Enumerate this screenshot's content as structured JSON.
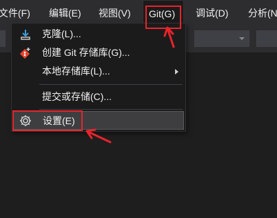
{
  "menubar": {
    "items": [
      {
        "label": "文件(F)"
      },
      {
        "label": "编辑(E)"
      },
      {
        "label": "视图(V)"
      },
      {
        "label": "Git(G)"
      },
      {
        "label": "调试(D)"
      },
      {
        "label": "分析(N"
      }
    ]
  },
  "git_menu": {
    "items": [
      {
        "label": "克隆(L)...",
        "icon": "clone-download-icon"
      },
      {
        "label": "创建 Git 存储库(G)...",
        "icon": "create-git-repo-icon"
      },
      {
        "label": "本地存储库(L)...",
        "has_submenu": true
      },
      {
        "label": "提交或存储(C)..."
      },
      {
        "label": "设置(E)",
        "icon": "gear-icon"
      }
    ]
  },
  "colors": {
    "annotation_red": "#e8242b",
    "menu_bg": "#1b1b1c",
    "bar_bg": "#2d2d30",
    "text": "#f1f1f1"
  }
}
